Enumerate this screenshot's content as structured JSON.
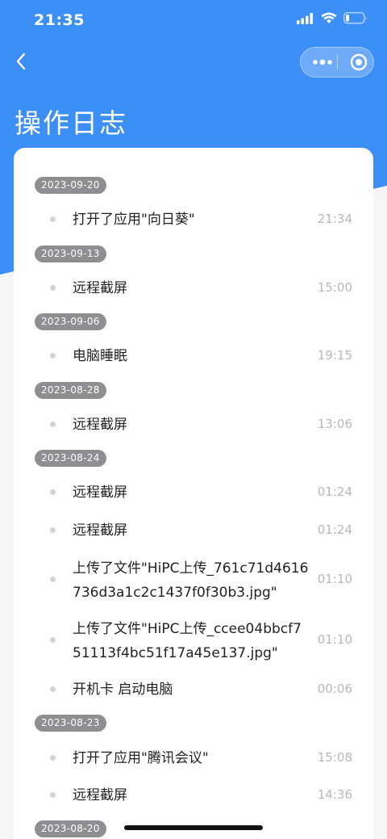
{
  "status_bar": {
    "time": "21:35",
    "icons": [
      "cellular-signal-icon",
      "wifi-icon",
      "battery-low-icon"
    ]
  },
  "nav": {
    "title": "操作日志",
    "back_icon": "chevron-left-icon",
    "capsule_icons": [
      "more-dots-icon",
      "target-circle-icon"
    ]
  },
  "colors": {
    "header_blue": "#3c8ff7",
    "badge_gray": "#8e8e93",
    "time_gray": "#b8b8bc"
  },
  "logs": [
    {
      "date": "2023-09-20",
      "entries": [
        {
          "text": "打开了应用\"向日葵\"",
          "time": "21:34"
        }
      ]
    },
    {
      "date": "2023-09-13",
      "entries": [
        {
          "text": "远程截屏",
          "time": "15:00"
        }
      ]
    },
    {
      "date": "2023-09-06",
      "entries": [
        {
          "text": "电脑睡眠",
          "time": "19:15"
        }
      ]
    },
    {
      "date": "2023-08-28",
      "entries": [
        {
          "text": "远程截屏",
          "time": "13:06"
        }
      ]
    },
    {
      "date": "2023-08-24",
      "entries": [
        {
          "text": "远程截屏",
          "time": "01:24"
        },
        {
          "text": "远程截屏",
          "time": "01:24"
        },
        {
          "text_line1": "上传了文件\"HiPC上传_761c71d4616",
          "text_line2": "736d3a1c2c1437f0f30b3.jpg\"",
          "time": "01:10"
        },
        {
          "text_line1": "上传了文件\"HiPC上传_ccee04bbcf7",
          "text_line2": "51113f4bc51f17a45e137.jpg\"",
          "time": "01:10"
        },
        {
          "text": "开机卡 启动电脑",
          "time": "00:06"
        }
      ]
    },
    {
      "date": "2023-08-23",
      "entries": [
        {
          "text": "打开了应用\"腾讯会议\"",
          "time": "15:08"
        },
        {
          "text": "远程截屏",
          "time": "14:36"
        }
      ]
    },
    {
      "date": "2023-08-20",
      "entries": []
    }
  ]
}
